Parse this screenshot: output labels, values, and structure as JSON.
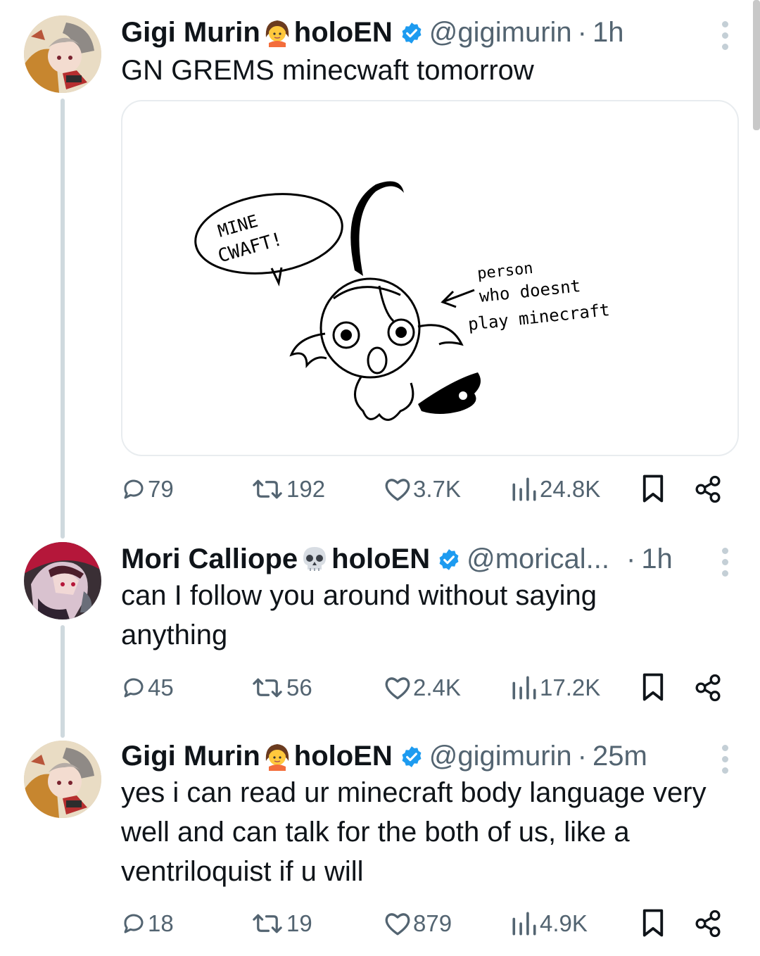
{
  "tweets": [
    {
      "name": "Gigi Murin",
      "org": "holoEN",
      "name_emoji": "girl-emoji",
      "handle": "@gigimurin",
      "dot": "·",
      "time": "1h",
      "text": "GN GREMS minecwaft tomorrow",
      "media": {
        "bubble_line1": "MINE",
        "bubble_line2": "CWAFT!",
        "note_line1": "person",
        "note_line2": "who doesnt",
        "note_line3": "play minecraft"
      },
      "replies": "79",
      "reposts": "192",
      "likes": "3.7K",
      "views": "24.8K"
    },
    {
      "name": "Mori Calliope",
      "org": "holoEN",
      "name_emoji": "skull-emoji",
      "handle": "@morical...",
      "dot": "·",
      "time": "1h",
      "text": "can I follow you around without saying anything",
      "replies": "45",
      "reposts": "56",
      "likes": "2.4K",
      "views": "17.2K"
    },
    {
      "name": "Gigi Murin",
      "org": "holoEN",
      "name_emoji": "girl-emoji",
      "handle": "@gigimurin",
      "dot": "·",
      "time": "25m",
      "text": "yes i can read ur minecraft body language very well and can talk for the both of us, like a ventriloquist if u will",
      "replies": "18",
      "reposts": "19",
      "likes": "879",
      "views": "4.9K"
    }
  ],
  "colors": {
    "text": "#0f1419",
    "muted": "#536471",
    "verified": "#1d9bf0",
    "thread_line": "#cfd9de"
  }
}
